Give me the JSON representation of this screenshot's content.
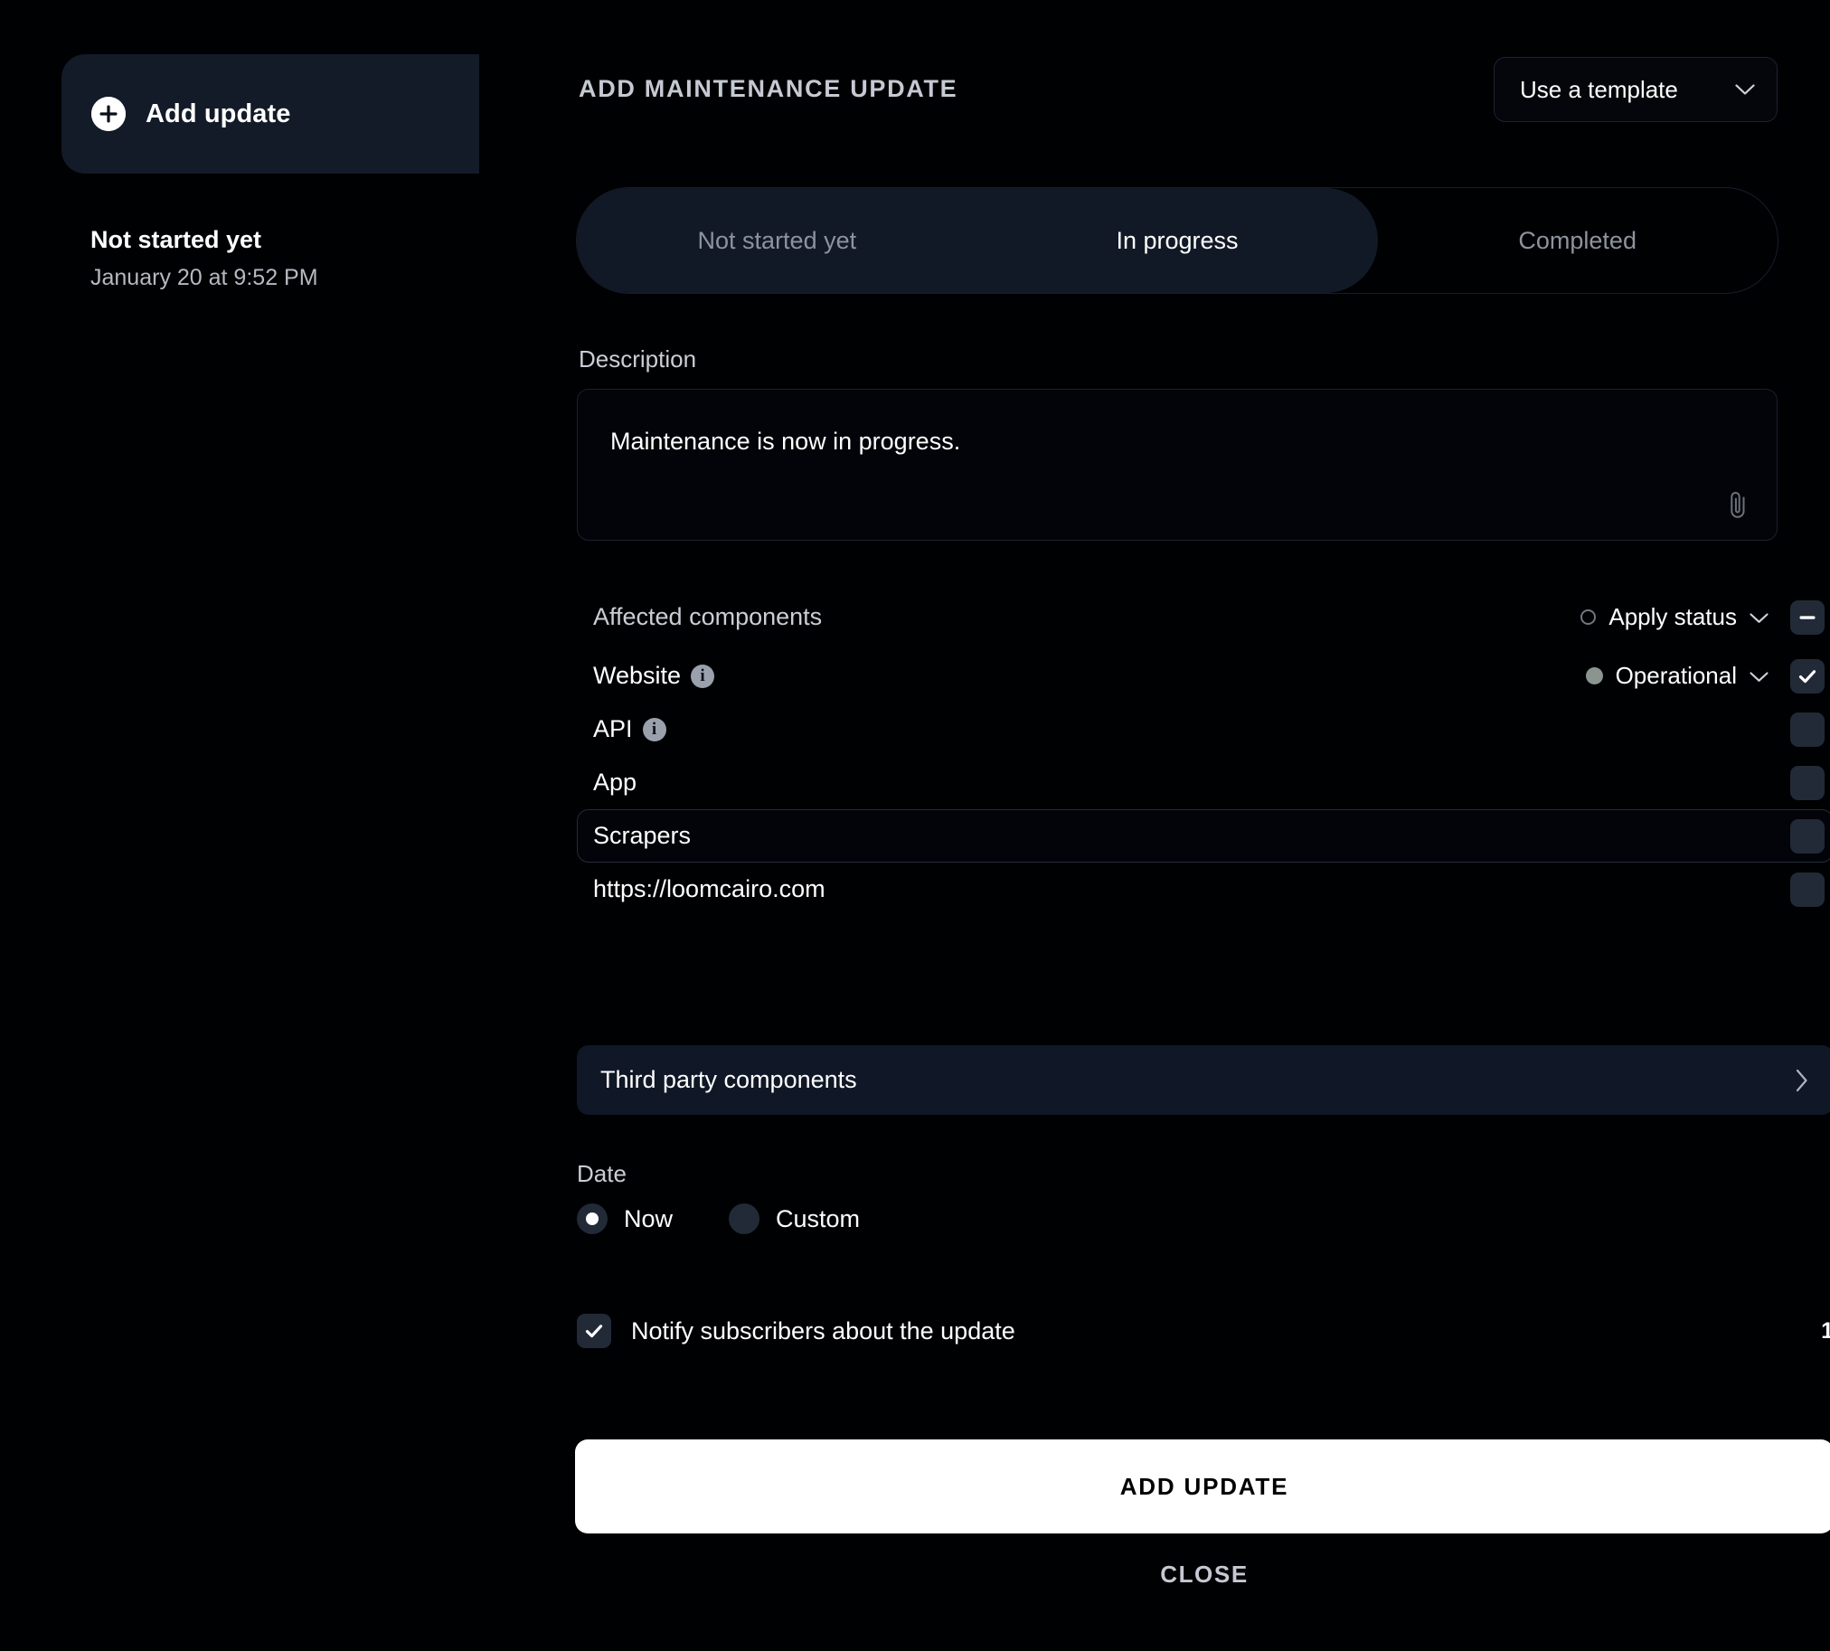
{
  "colors": {
    "background": "#000103",
    "card": "#131a28",
    "panel": "#101726",
    "checkbox": "#222a38",
    "accent_white": "#ffffff",
    "muted_text": "#8d939e",
    "status_dot_operational": "#8b958f"
  },
  "sidebar": {
    "add_update_button_label": "Add update",
    "add_icon": "plus-circle-icon",
    "entry": {
      "title": "Not started yet",
      "date": "January 20 at 9:52 PM"
    }
  },
  "header": {
    "title": "ADD MAINTENANCE UPDATE",
    "template_select": {
      "label": "Use a template",
      "icon": "chevron-down-icon"
    }
  },
  "tabs": [
    {
      "label": "Not started yet",
      "state": "inactive"
    },
    {
      "label": "In progress",
      "state": "active"
    },
    {
      "label": "Completed",
      "state": "outside"
    }
  ],
  "description": {
    "label": "Description",
    "value": "Maintenance is now in progress.",
    "attach_icon": "paperclip-icon"
  },
  "components": {
    "header": {
      "label": "Affected components",
      "status_label": "Apply status",
      "status_icon": "circle-outline-icon",
      "chevron": "chevron-down-icon",
      "checkbox_state": "indeterminate"
    },
    "rows": [
      {
        "name": "Website",
        "has_info": true,
        "status": "Operational",
        "status_dot": "filled",
        "checkbox_state": "checked",
        "focused": false
      },
      {
        "name": "API",
        "has_info": true,
        "status": "",
        "status_dot": "none",
        "checkbox_state": "unchecked",
        "focused": false
      },
      {
        "name": "App",
        "has_info": false,
        "status": "",
        "status_dot": "none",
        "checkbox_state": "unchecked",
        "focused": false
      },
      {
        "name": "Scrapers",
        "has_info": false,
        "status": "",
        "status_dot": "none",
        "checkbox_state": "unchecked",
        "focused": true
      },
      {
        "name": "https://loomcairo.com",
        "has_info": false,
        "status": "",
        "status_dot": "none",
        "checkbox_state": "unchecked",
        "focused": false
      }
    ]
  },
  "third_party": {
    "label": "Third party components",
    "icon": "chevron-right-icon"
  },
  "date": {
    "label": "Date",
    "options": [
      {
        "label": "Now",
        "selected": true
      },
      {
        "label": "Custom",
        "selected": false
      }
    ]
  },
  "notify": {
    "label": "Notify subscribers about the update",
    "checked": true,
    "count": "1"
  },
  "actions": {
    "primary_label": "ADD UPDATE",
    "close_label": "CLOSE"
  }
}
